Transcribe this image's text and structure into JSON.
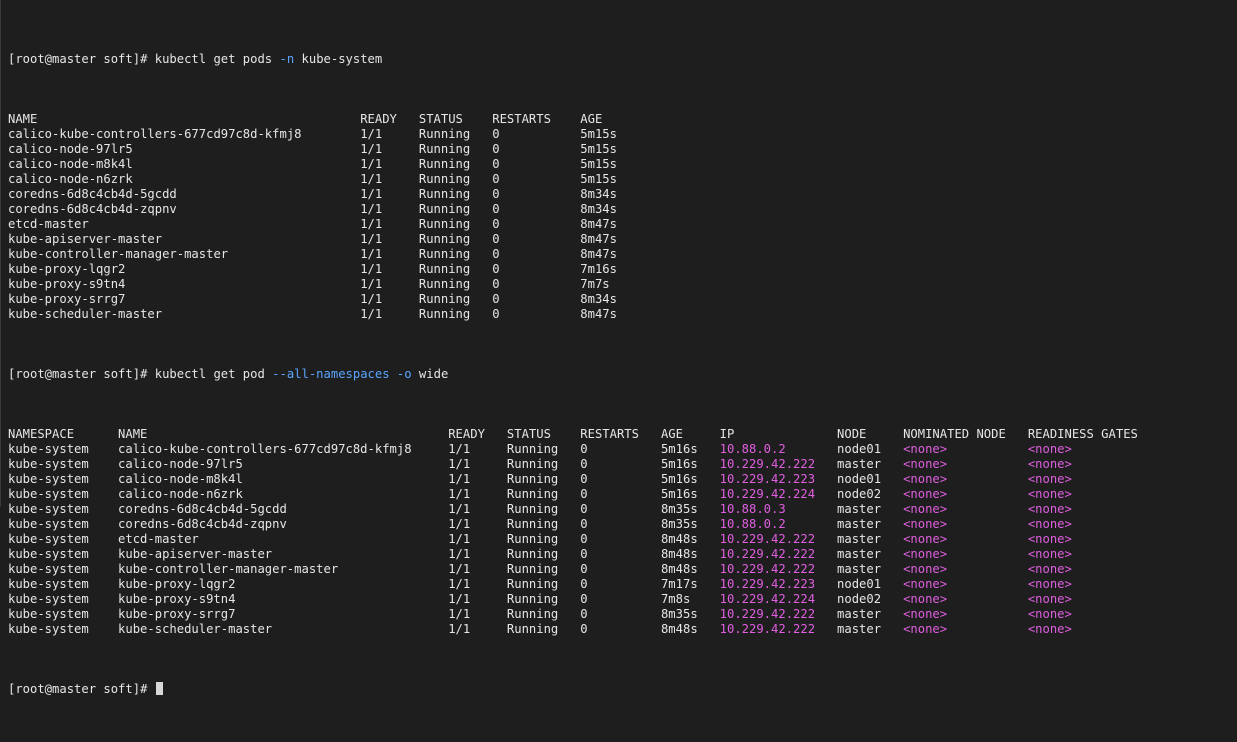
{
  "terminal": {
    "cmd1": {
      "prompt": "[root@master soft]# ",
      "pre": "kubectl get pods ",
      "flag": "-n",
      "post": " kube-system"
    },
    "table1": {
      "headers": [
        "NAME",
        "READY",
        "STATUS",
        "RESTARTS",
        "AGE"
      ],
      "rows": [
        [
          "calico-kube-controllers-677cd97c8d-kfmj8",
          "1/1",
          "Running",
          "0",
          "5m15s"
        ],
        [
          "calico-node-97lr5",
          "1/1",
          "Running",
          "0",
          "5m15s"
        ],
        [
          "calico-node-m8k4l",
          "1/1",
          "Running",
          "0",
          "5m15s"
        ],
        [
          "calico-node-n6zrk",
          "1/1",
          "Running",
          "0",
          "5m15s"
        ],
        [
          "coredns-6d8c4cb4d-5gcdd",
          "1/1",
          "Running",
          "0",
          "8m34s"
        ],
        [
          "coredns-6d8c4cb4d-zqpnv",
          "1/1",
          "Running",
          "0",
          "8m34s"
        ],
        [
          "etcd-master",
          "1/1",
          "Running",
          "0",
          "8m47s"
        ],
        [
          "kube-apiserver-master",
          "1/1",
          "Running",
          "0",
          "8m47s"
        ],
        [
          "kube-controller-manager-master",
          "1/1",
          "Running",
          "0",
          "8m47s"
        ],
        [
          "kube-proxy-lqgr2",
          "1/1",
          "Running",
          "0",
          "7m16s"
        ],
        [
          "kube-proxy-s9tn4",
          "1/1",
          "Running",
          "0",
          "7m7s"
        ],
        [
          "kube-proxy-srrg7",
          "1/1",
          "Running",
          "0",
          "8m34s"
        ],
        [
          "kube-scheduler-master",
          "1/1",
          "Running",
          "0",
          "8m47s"
        ]
      ]
    },
    "cmd2": {
      "prompt": "[root@master soft]# ",
      "pre": "kubectl get pod ",
      "flag1": "--all-namespaces",
      "mid": " ",
      "flag2": "-o",
      "post": " wide"
    },
    "table2": {
      "headers": [
        "NAMESPACE",
        "NAME",
        "READY",
        "STATUS",
        "RESTARTS",
        "AGE",
        "IP",
        "NODE",
        "NOMINATED NODE",
        "READINESS GATES"
      ],
      "rows": [
        [
          "kube-system",
          "calico-kube-controllers-677cd97c8d-kfmj8",
          "1/1",
          "Running",
          "0",
          "5m16s",
          "10.88.0.2",
          "node01",
          "<none>",
          "<none>"
        ],
        [
          "kube-system",
          "calico-node-97lr5",
          "1/1",
          "Running",
          "0",
          "5m16s",
          "10.229.42.222",
          "master",
          "<none>",
          "<none>"
        ],
        [
          "kube-system",
          "calico-node-m8k4l",
          "1/1",
          "Running",
          "0",
          "5m16s",
          "10.229.42.223",
          "node01",
          "<none>",
          "<none>"
        ],
        [
          "kube-system",
          "calico-node-n6zrk",
          "1/1",
          "Running",
          "0",
          "5m16s",
          "10.229.42.224",
          "node02",
          "<none>",
          "<none>"
        ],
        [
          "kube-system",
          "coredns-6d8c4cb4d-5gcdd",
          "1/1",
          "Running",
          "0",
          "8m35s",
          "10.88.0.3",
          "master",
          "<none>",
          "<none>"
        ],
        [
          "kube-system",
          "coredns-6d8c4cb4d-zqpnv",
          "1/1",
          "Running",
          "0",
          "8m35s",
          "10.88.0.2",
          "master",
          "<none>",
          "<none>"
        ],
        [
          "kube-system",
          "etcd-master",
          "1/1",
          "Running",
          "0",
          "8m48s",
          "10.229.42.222",
          "master",
          "<none>",
          "<none>"
        ],
        [
          "kube-system",
          "kube-apiserver-master",
          "1/1",
          "Running",
          "0",
          "8m48s",
          "10.229.42.222",
          "master",
          "<none>",
          "<none>"
        ],
        [
          "kube-system",
          "kube-controller-manager-master",
          "1/1",
          "Running",
          "0",
          "8m48s",
          "10.229.42.222",
          "master",
          "<none>",
          "<none>"
        ],
        [
          "kube-system",
          "kube-proxy-lqgr2",
          "1/1",
          "Running",
          "0",
          "7m17s",
          "10.229.42.223",
          "node01",
          "<none>",
          "<none>"
        ],
        [
          "kube-system",
          "kube-proxy-s9tn4",
          "1/1",
          "Running",
          "0",
          "7m8s",
          "10.229.42.224",
          "node02",
          "<none>",
          "<none>"
        ],
        [
          "kube-system",
          "kube-proxy-srrg7",
          "1/1",
          "Running",
          "0",
          "8m35s",
          "10.229.42.222",
          "master",
          "<none>",
          "<none>"
        ],
        [
          "kube-system",
          "kube-scheduler-master",
          "1/1",
          "Running",
          "0",
          "8m48s",
          "10.229.42.222",
          "master",
          "<none>",
          "<none>"
        ]
      ]
    },
    "prompt_last": "[root@master soft]# ",
    "colors": {
      "background": "#1e1e1e",
      "text": "#e6e6e6",
      "flag": "#5aa6ff",
      "ip_and_none": "#e05ee0",
      "cursor": "#d8d8d8"
    }
  }
}
